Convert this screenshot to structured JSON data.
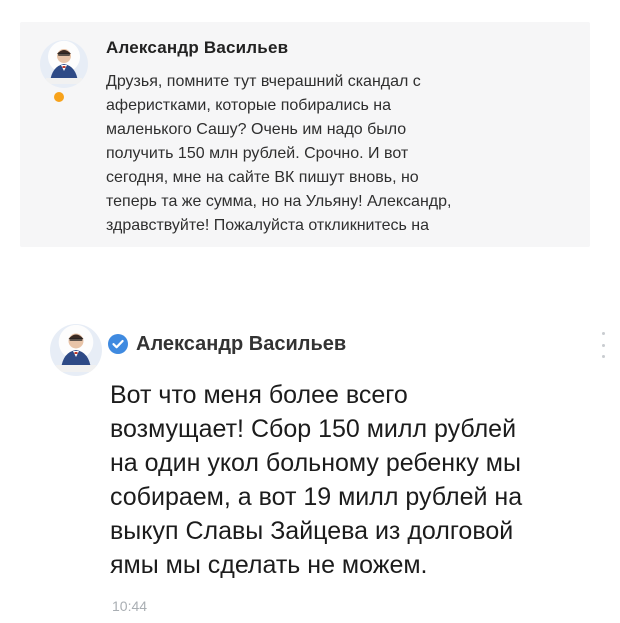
{
  "message_preview": {
    "author": "Александр Васильев",
    "text": "Друзья, помните тут вчерашний скандал с\nаферистками, которые побирались на\nмаленького Сашу? Очень им надо было\nполучить 150 млн рублей. Срочно. И вот\nсегодня, мне на сайте ВК пишут вновь, но\nтеперь та же сумма, но на Ульяну! Александр,\nздравствуйте! Пожалуйста откликнитесь на",
    "status_color": "#f7a21b"
  },
  "message": {
    "author": "Александр Васильев",
    "verified_icon": "verified-check-icon",
    "verified_color": "#3f8ae0",
    "text": "Вот что меня более всего\nвозмущает! Сбор 150 милл рублей\nна один укол больному ребенку мы\nсобираем, а вот 19 милл рублей на\nвыкуп Славы Зайцева из долговой\nямы мы сделать не можем.",
    "time": "10:44",
    "menu_icon": "more-vertical-icon"
  }
}
